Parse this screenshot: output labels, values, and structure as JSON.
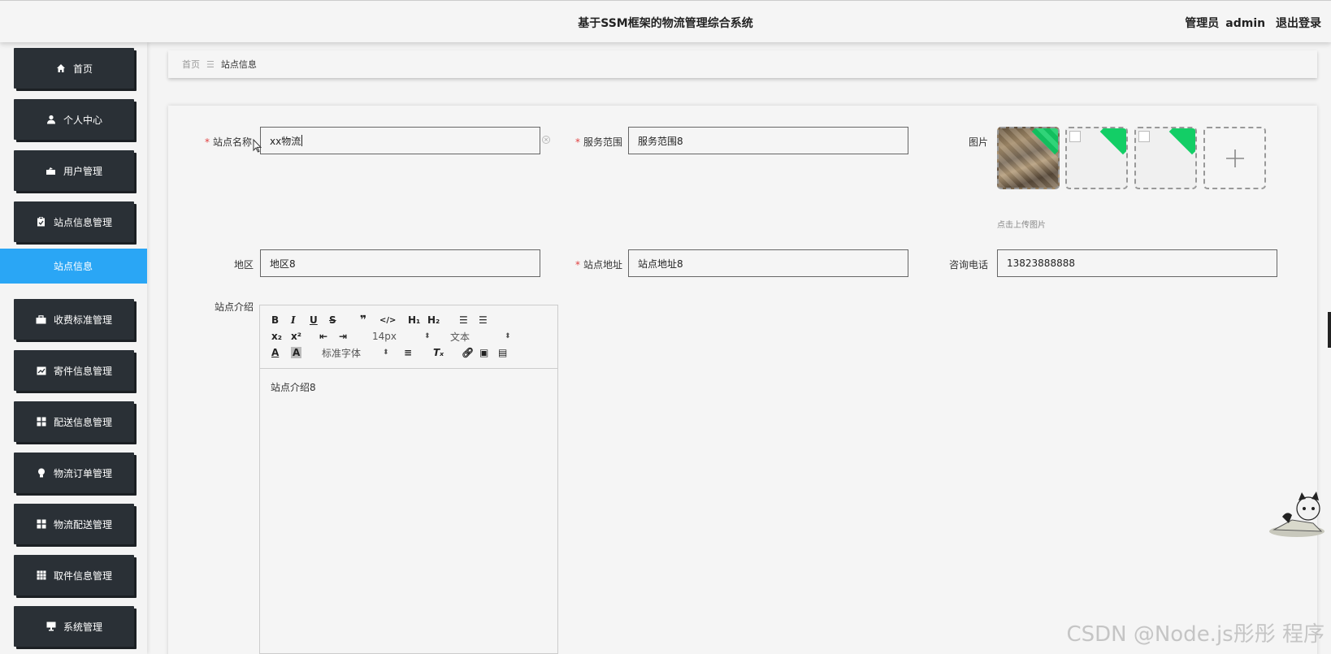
{
  "header": {
    "title": "基于SSM框架的物流管理综合系统",
    "user_role": "管理员",
    "user_name": "admin",
    "logout_label": "退出登录"
  },
  "sidebar": {
    "items": [
      {
        "label": "首页",
        "icon": "home-icon"
      },
      {
        "label": "个人中心",
        "icon": "user-icon"
      },
      {
        "label": "用户管理",
        "icon": "user-manage-icon"
      },
      {
        "label": "站点信息管理",
        "icon": "clipboard-icon"
      },
      {
        "label": "收费标准管理",
        "icon": "briefcase-icon"
      },
      {
        "label": "寄件信息管理",
        "icon": "chart-icon"
      },
      {
        "label": "配送信息管理",
        "icon": "grid-icon"
      },
      {
        "label": "物流订单管理",
        "icon": "lightbulb-icon"
      },
      {
        "label": "物流配送管理",
        "icon": "grid-icon"
      },
      {
        "label": "取件信息管理",
        "icon": "table-icon"
      },
      {
        "label": "系统管理",
        "icon": "monitor-icon"
      }
    ],
    "active_submenu": "站点信息"
  },
  "breadcrumb": {
    "home": "首页",
    "separator": "☰",
    "current": "站点信息"
  },
  "form": {
    "station_name": {
      "label": "站点名称",
      "value": "xx物流",
      "required": true
    },
    "service_area": {
      "label": "服务范围",
      "value": "服务范围8",
      "required": true
    },
    "image": {
      "label": "图片",
      "hint": "点击上传图片"
    },
    "region": {
      "label": "地区",
      "value": "地区8"
    },
    "station_address": {
      "label": "站点地址",
      "value": "站点地址8",
      "required": true
    },
    "phone": {
      "label": "咨询电话",
      "value": "13823888888"
    },
    "intro": {
      "label": "站点介绍",
      "value": "站点介绍8"
    }
  },
  "editor_toolbar": {
    "font_size": "14px",
    "block_type": "文本",
    "font_family": "标准字体"
  },
  "watermark": "CSDN @Node.js彤彤 程序",
  "colors": {
    "sidebar_bg": "#2a3036",
    "active_submenu": "#2aa6f5",
    "required_mark": "#e04040",
    "upload_success": "#13ce66"
  }
}
